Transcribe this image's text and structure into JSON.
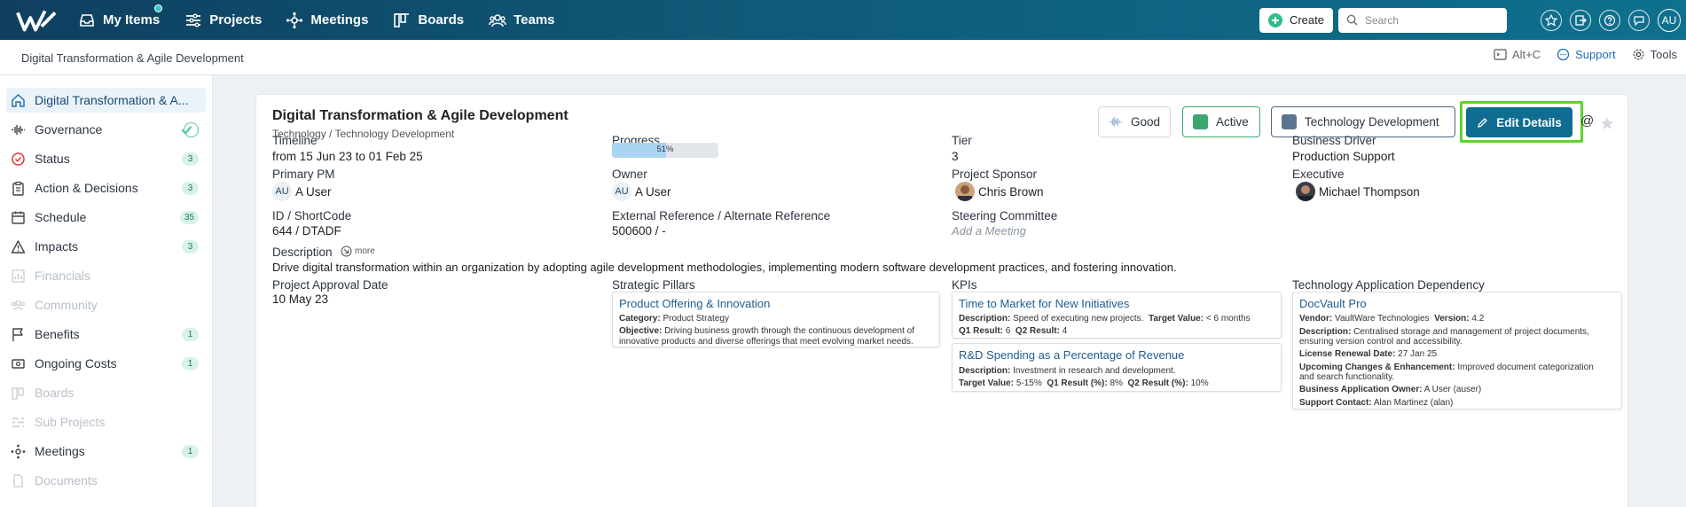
{
  "topnav": {
    "items": [
      {
        "label": "My Items",
        "icon": "inbox-icon"
      },
      {
        "label": "Projects",
        "icon": "projects-icon"
      },
      {
        "label": "Meetings",
        "icon": "meetings-icon"
      },
      {
        "label": "Boards",
        "icon": "boards-icon"
      },
      {
        "label": "Teams",
        "icon": "teams-icon"
      }
    ],
    "create_label": "Create",
    "search_placeholder": "Search",
    "avatar": "AU"
  },
  "breadcrumb": "Digital Transformation & Agile Development",
  "subbar": {
    "shortcut": "Alt+C",
    "support": "Support",
    "tools": "Tools"
  },
  "sidebar": {
    "items": [
      {
        "label": "Digital Transformation & A...",
        "icon": "home-icon",
        "badge": "",
        "state": "active"
      },
      {
        "label": "Governance",
        "icon": "governance-icon",
        "badge": "",
        "state": "normal"
      },
      {
        "label": "Status",
        "icon": "status-icon",
        "badge": "3",
        "state": "normal"
      },
      {
        "label": "Action & Decisions",
        "icon": "clipboard-icon",
        "badge": "3",
        "state": "normal"
      },
      {
        "label": "Schedule",
        "icon": "calendar-icon",
        "badge": "35",
        "state": "normal"
      },
      {
        "label": "Impacts",
        "icon": "warning-icon",
        "badge": "3",
        "state": "normal"
      },
      {
        "label": "Financials",
        "icon": "financials-icon",
        "badge": "",
        "state": "disabled"
      },
      {
        "label": "Community",
        "icon": "community-icon",
        "badge": "",
        "state": "disabled"
      },
      {
        "label": "Benefits",
        "icon": "flag-icon",
        "badge": "1",
        "state": "normal"
      },
      {
        "label": "Ongoing Costs",
        "icon": "costs-icon",
        "badge": "1",
        "state": "normal"
      },
      {
        "label": "Boards",
        "icon": "boards-icon",
        "badge": "",
        "state": "disabled"
      },
      {
        "label": "Sub Projects",
        "icon": "subprojects-icon",
        "badge": "",
        "state": "disabled"
      },
      {
        "label": "Meetings",
        "icon": "meetings-icon",
        "badge": "1",
        "state": "normal"
      },
      {
        "label": "Documents",
        "icon": "documents-icon",
        "badge": "",
        "state": "disabled"
      }
    ]
  },
  "project": {
    "title": "Digital Transformation & Agile Development",
    "subtitle": "Technology / Technology Development",
    "health": "Good",
    "status": "Active",
    "status_color": "#3aa76d",
    "category": "Technology Development",
    "category_color": "#5a7590",
    "edit_label": "Edit Details",
    "fields": {
      "timeline_label": "Timeline",
      "timeline_value": "from 15 Jun 23 to 01 Feb 25",
      "progress_label": "Progress",
      "progress_value": 0.51,
      "progress_text": "51%",
      "tier_label": "Tier",
      "tier_value": "3",
      "driver_label": "Business Driver",
      "driver_value": "Production Support",
      "pm_label": "Primary PM",
      "pm_initials": "AU",
      "pm_value": "A User",
      "owner_label": "Owner",
      "owner_initials": "AU",
      "owner_value": "A User",
      "sponsor_label": "Project Sponsor",
      "sponsor_value": "Chris Brown",
      "exec_label": "Executive",
      "exec_value": "Michael Thompson",
      "id_label": "ID / ShortCode",
      "id_value": "644 / DTADF",
      "ext_label": "External Reference / Alternate Reference",
      "ext_value": "500600 / -",
      "steering_label": "Steering Committee",
      "steering_placeholder": "Add a Meeting",
      "desc_label": "Description",
      "desc_more": "more",
      "desc_value": "Drive digital transformation within an organization by adopting agile development methodologies, implementing modern software development practices, and fostering innovation.",
      "approval_label": "Project Approval Date",
      "approval_value": "10 May 23",
      "pillars_label": "Strategic Pillars",
      "kpis_label": "KPIs",
      "dep_label": "Technology Application Dependency"
    },
    "pillar": {
      "title": "Product Offering & Innovation",
      "category_key": "Category:",
      "category": "Product Strategy",
      "objective_key": "Objective:",
      "objective_1": "Driving business growth through the continuous development of",
      "objective_2": "innovative products and diverse offerings that meet evolving market needs."
    },
    "kpis": [
      {
        "title": "Time to Market for New Initiatives",
        "desc_key": "Description:",
        "desc": "Speed of executing new projects.",
        "target_key": "Target Value:",
        "target": "< 6 months",
        "r1_key": "Q1 Result:",
        "r1": "6",
        "r2_key": "Q2 Result:",
        "r2": "4"
      },
      {
        "title": "R&D Spending as a Percentage of Revenue",
        "desc_key": "Description:",
        "desc": "Investment in research and development.",
        "target_key": "Target Value:",
        "target": "5-15%",
        "r1_key": "Q1 Result (%):",
        "r1": "8%",
        "r2_key": "Q2 Result (%):",
        "r2": "10%"
      }
    ],
    "dependency": {
      "title": "DocVault Pro",
      "vendor_key": "Vendor:",
      "vendor": "VaultWare Technologies",
      "version_key": "Version:",
      "version": "4.2",
      "desc_key": "Description:",
      "desc_1": "Centralised storage and management of project documents,",
      "desc_2": "ensuring version control and accessibility.",
      "renewal_key": "License Renewal Date:",
      "renewal": "27 Jan 25",
      "changes_key": "Upcoming Changes & Enhancement:",
      "changes_1": "Improved document categorization",
      "changes_2": "and search functionality.",
      "owner_key": "Business Application Owner:",
      "owner": "A User (auser)",
      "contact_key": "Support Contact:",
      "contact": "Alan Martinez (alan)"
    }
  }
}
